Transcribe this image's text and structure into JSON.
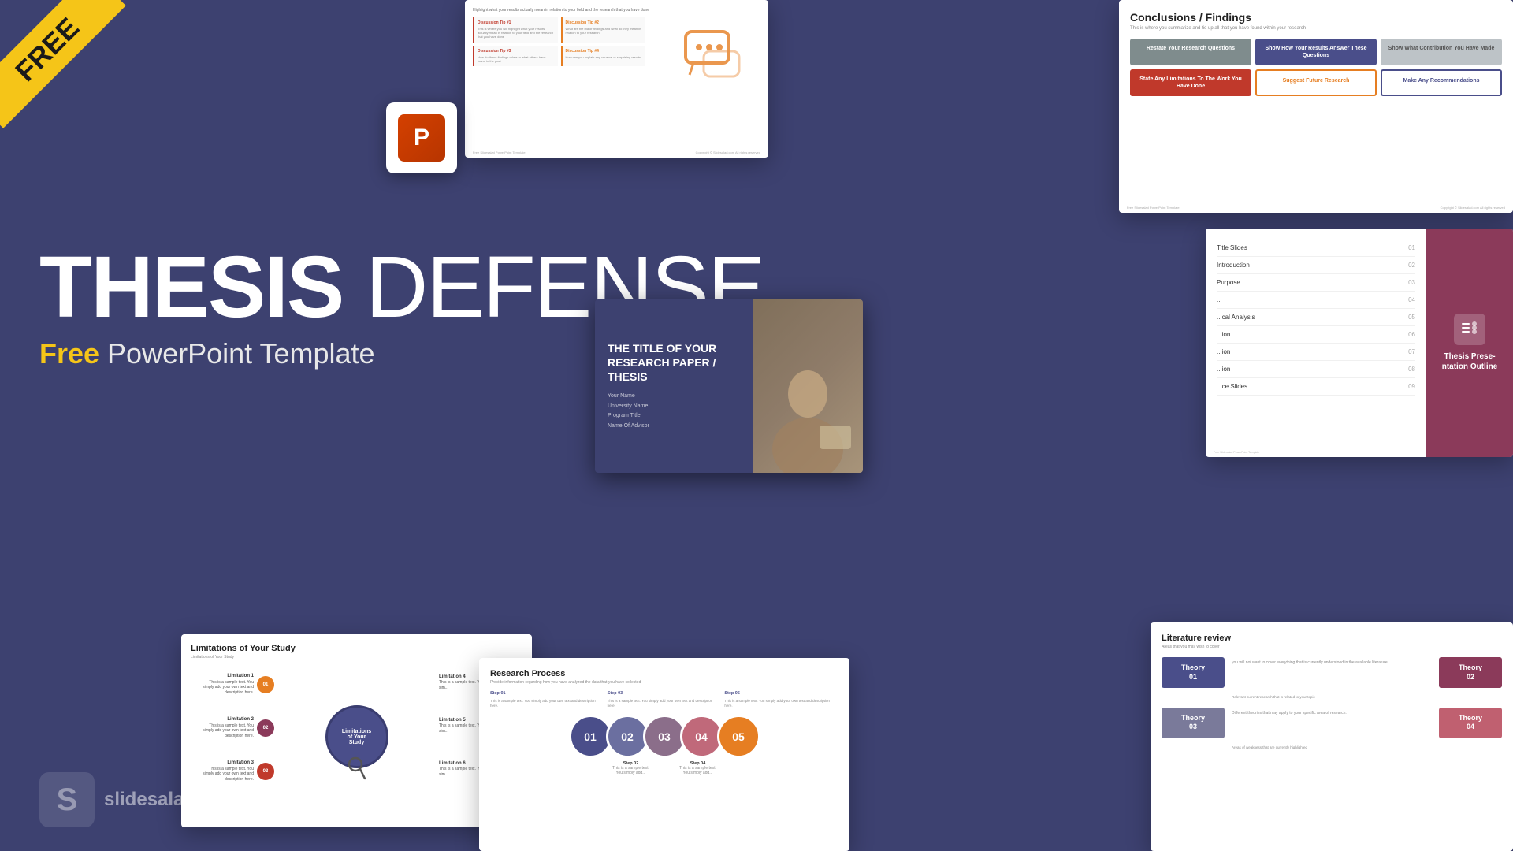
{
  "banner": {
    "free_label": "FREE"
  },
  "main_title": {
    "line1": "THESIS",
    "line1_part2": " DEFENSE",
    "subtitle_free": "Free",
    "subtitle_rest": " PowerPoint Template"
  },
  "logo": {
    "icon": "S",
    "name": "slidesalad"
  },
  "slide_discussion": {
    "header_text": "Highlight what your results actually mean in relation to your field and the research that you have done",
    "tips": [
      {
        "label": "Discussion Tip #1",
        "body": "This is where you will highlight what your results actually mean in relation to your field and the research that you have done",
        "highlight": false
      },
      {
        "label": "Discussion Tip #2",
        "body": "What are the major findings and what do they mean in relation to your research",
        "highlight": true
      },
      {
        "label": "Discussion Tip #3",
        "body": "How do these findings relate to what others have found in the past",
        "highlight": false
      },
      {
        "label": "Discussion Tip #4",
        "body": "How can you explain any unusual or surprising results",
        "highlight": true
      }
    ],
    "footer_left": "Free Slidesalad PowerPoint Template",
    "footer_right": "Copyright © Slidesalad.com All rights reserved"
  },
  "slide_conclusions": {
    "title": "Conclusions / Findings",
    "subtitle": "This is where you summarize and tie up all that you have found within your research",
    "cards": [
      {
        "label": "Restate Your Research Questions",
        "style": "gray"
      },
      {
        "label": "Show How Your Results Answer These Questions",
        "style": "purple"
      },
      {
        "label": "Show What Contribution You Have Made",
        "style": "light-gray"
      },
      {
        "label": "State Any Limitations To The Work You Have Done",
        "style": "red"
      },
      {
        "label": "Suggest Future Research",
        "style": "yellow-outline"
      },
      {
        "label": "Make Any Recommendations",
        "style": "purple-outline"
      }
    ],
    "footer_left": "Free Slidesalad PowerPoint Template",
    "footer_right": "Copyright © Slidesalad.com All rights reserved"
  },
  "slide_outline": {
    "items": [
      {
        "label": "Title Slides",
        "num": "01"
      },
      {
        "label": "Introduction",
        "num": "02"
      },
      {
        "label": "Purpose",
        "num": "03"
      },
      {
        "label": "...",
        "num": "04"
      },
      {
        "label": "...al Analysis",
        "num": "05"
      },
      {
        "label": "...ion",
        "num": "06"
      },
      {
        "label": "...ion",
        "num": "07"
      },
      {
        "label": "...ion",
        "num": "08"
      },
      {
        "label": "...ce Slides",
        "num": "09"
      }
    ],
    "right_panel_title": "Thesis Presentation Outline",
    "footer": "Free Slidesalad PowerPoint Template"
  },
  "slide_research": {
    "title": "THE TITLE OF YOUR RESEARCH PAPER / THESIS",
    "name": "Your Name",
    "university": "University Name",
    "program": "Program Title",
    "advisor": "Name Of Advisor"
  },
  "slide_limitations": {
    "title": "Limitations of Your Study",
    "subtitle": "Limitations of Your Study",
    "center_label": "Limitations of Your Study",
    "nodes": [
      {
        "id": "01",
        "label": "Limitation 1",
        "desc": "This is a sample text. You simply add your own text and description here.",
        "color": "#e67e22",
        "pos": "top-left"
      },
      {
        "id": "02",
        "label": "Limitation 2",
        "desc": "This is a sample text. You simply add your own text and description here.",
        "color": "#8b3a5a",
        "pos": "mid-left"
      },
      {
        "id": "03",
        "label": "Limitation 3",
        "desc": "This is a sample text. You simply add your own text and description here.",
        "color": "#c0392b",
        "pos": "bot-left"
      },
      {
        "id": "04",
        "label": "Limitation 4",
        "desc": "This is a sample text. You sim...",
        "color": "#e67e22",
        "pos": "top-right"
      },
      {
        "id": "05",
        "label": "Limitation 5",
        "desc": "This is a sample text. You sim...",
        "color": "#f0a500",
        "pos": "mid-right"
      },
      {
        "id": "06",
        "label": "Limitation 6",
        "desc": "This is a sample text. You sim...",
        "color": "#4a4e8a",
        "pos": "bot-right"
      }
    ]
  },
  "slide_process": {
    "title": "Research Process",
    "subtitle": "Provide information regarding how you have analyzed the data that you have collected",
    "steps": [
      {
        "label": "Step 01",
        "desc": "This is a sample text. You simply add your own text and description here."
      },
      {
        "label": "Step 03",
        "desc": "This is a sample text. You simply add your own text and description here."
      },
      {
        "label": "Step 05",
        "desc": "This is a sample text. You simply add your own text and description here."
      }
    ],
    "bottom_steps": [
      {
        "label": "Step 02",
        "desc": "This is a sample text. You simply add your own text and description here."
      },
      {
        "label": "Step 04",
        "desc": "This is a sample text. You simply add your own text and description here."
      }
    ],
    "circles": [
      "01",
      "02",
      "03",
      "04",
      "05"
    ]
  },
  "slide_literature": {
    "title": "Literature review",
    "subtitle": "Areas that you may wish to cover",
    "theories": [
      {
        "id": "Theory 01",
        "desc": "you will not want to cover everything that is currently understood in the available literature",
        "style": "t1"
      },
      {
        "id": "Theory 02",
        "desc": "Relevant current research that is related to your topic",
        "style": "t2"
      },
      {
        "id": "Theory 03",
        "desc": "Different theories that may apply to your specific area of research.",
        "style": "t3"
      },
      {
        "id": "Theory 04",
        "desc": "Areas of weakness that are currently highlighted",
        "style": "t4"
      }
    ]
  }
}
